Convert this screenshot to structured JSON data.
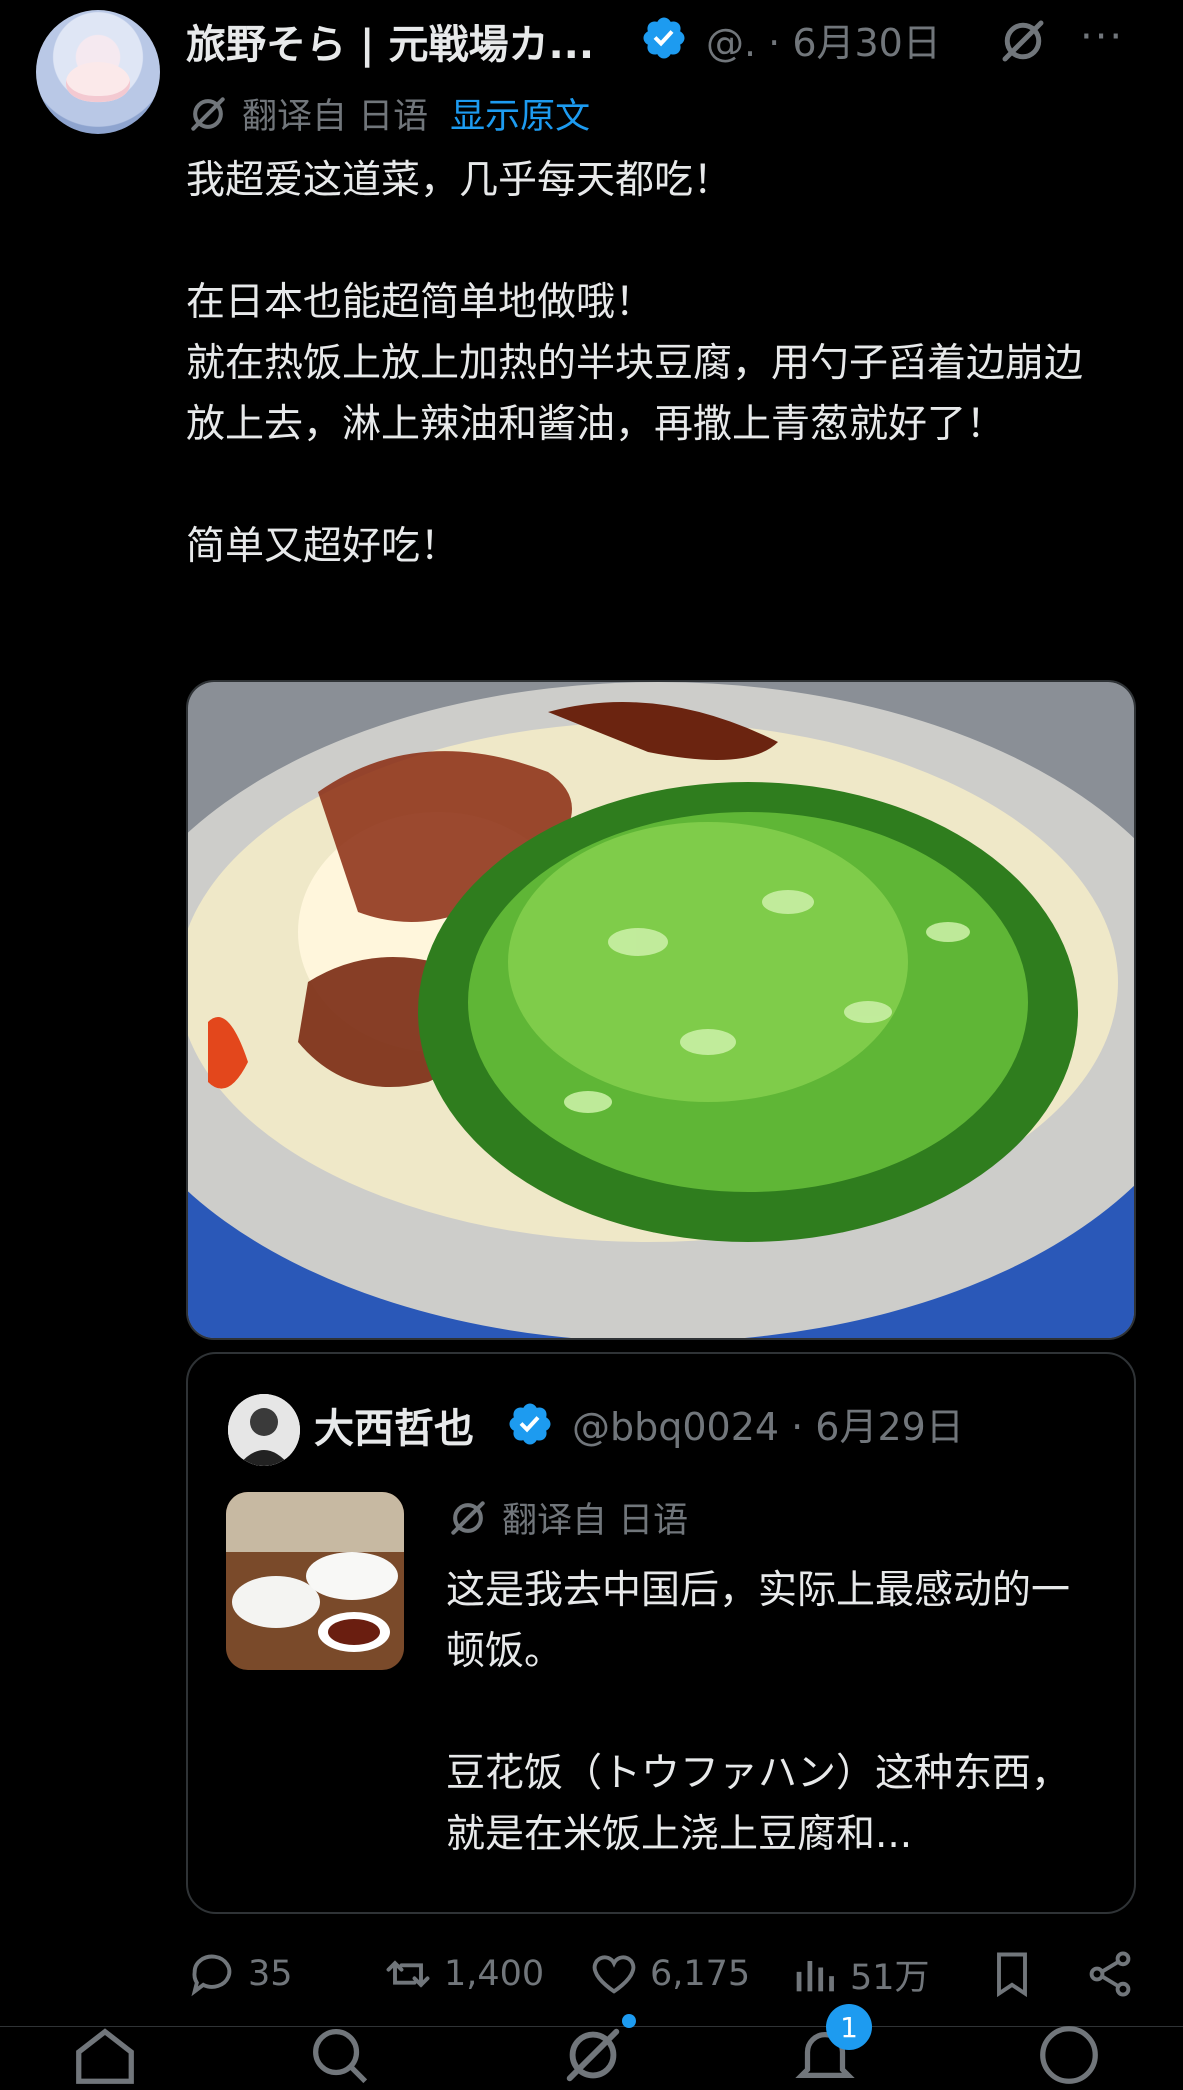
{
  "tweet": {
    "display_name": "旅野そら | 元戦場カ...",
    "meta": "@. · 6月30日",
    "more": "···",
    "translated_label": "翻译自 日语",
    "show_original": "显示原文",
    "text": "我超爱这道菜，几乎每天都吃！\n\n在日本也能超简单地做哦！\n就在热饭上放上加热的半块豆腐，用勺子舀着边崩边放上去，淋上辣油和酱油，再撒上青葱就好了！\n\n简单又超好吃！"
  },
  "quote": {
    "display_name": "大西哲也",
    "handle_date": "@bbq0024 · 6月29日",
    "translated_label": "翻译自 日语",
    "text": "这是我去中国后，实际上最感动的一顿饭。\n\n豆花饭（トウファハン）这种东西，就是在米饭上浇上豆腐和..."
  },
  "actions": {
    "replies": "35",
    "reposts": "1,400",
    "likes": "6,175",
    "views": "51万"
  },
  "nav": {
    "notifications_badge": "1"
  },
  "colors": {
    "background": "#000000",
    "text": "#e7e9ea",
    "muted": "#71767b",
    "accent": "#1d9bf0"
  },
  "icons": [
    "verified-badge-icon",
    "grok-icon",
    "more-icon",
    "translate-icon",
    "reply-icon",
    "repost-icon",
    "like-icon",
    "views-icon",
    "bookmark-icon",
    "share-icon",
    "home-icon",
    "search-icon",
    "grok-nav-icon",
    "notifications-icon",
    "messages-icon"
  ]
}
